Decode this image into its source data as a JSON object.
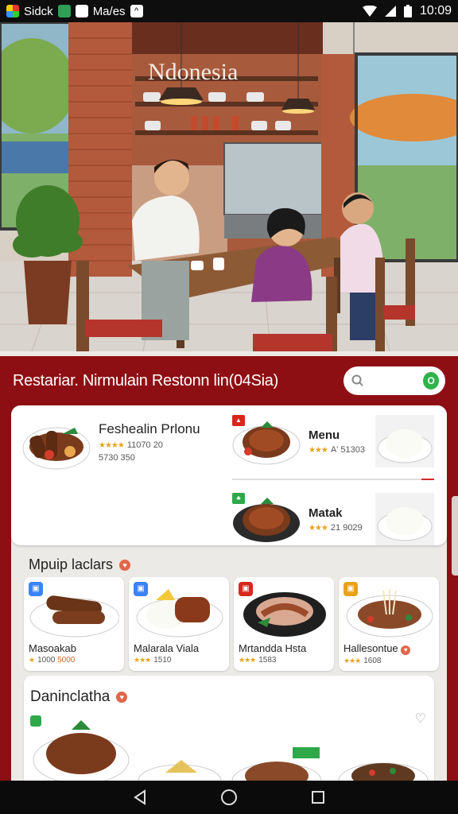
{
  "status_bar": {
    "left_apps": [
      "Sidck",
      "Ma/es"
    ],
    "time": "10:09"
  },
  "hero": {
    "sign_text": "Ndonesia"
  },
  "header": {
    "title": "Restariar. Nirmulain Restonn lin(04Sia)",
    "search_placeholder": ""
  },
  "featured": {
    "name": "Feshealin Prlonu",
    "rating": "11070 20",
    "sub": "5730 350",
    "menu_items": [
      {
        "title": "Menu",
        "rating": "A' 51303",
        "badge_color": "#d9261c",
        "badge_icon": "fire-badge"
      },
      {
        "title": "Matak",
        "rating": "21 9029",
        "badge_color": "#2fa84a",
        "badge_icon": "leaf-badge"
      }
    ]
  },
  "popular": {
    "title": "Mpuip laclars",
    "items": [
      {
        "name": "Masoakab",
        "rating": "1000",
        "extra": "5000",
        "tag_color": "#3b82f6"
      },
      {
        "name": "Malarala Viala",
        "rating": "1510",
        "extra": "",
        "tag_color": "#3b82f6"
      },
      {
        "name": "Mrtandda Hsta",
        "rating": "1583",
        "extra": "",
        "tag_color": "#d9261c"
      },
      {
        "name": "Hallesontue",
        "rating": "1608",
        "extra": "",
        "tag_color": "#e8a21a"
      }
    ]
  },
  "bottom": {
    "title": "Daninclatha"
  },
  "colors": {
    "brand_red": "#8e0f13",
    "accent_green": "#2fb34a",
    "star": "#e8a21a"
  }
}
